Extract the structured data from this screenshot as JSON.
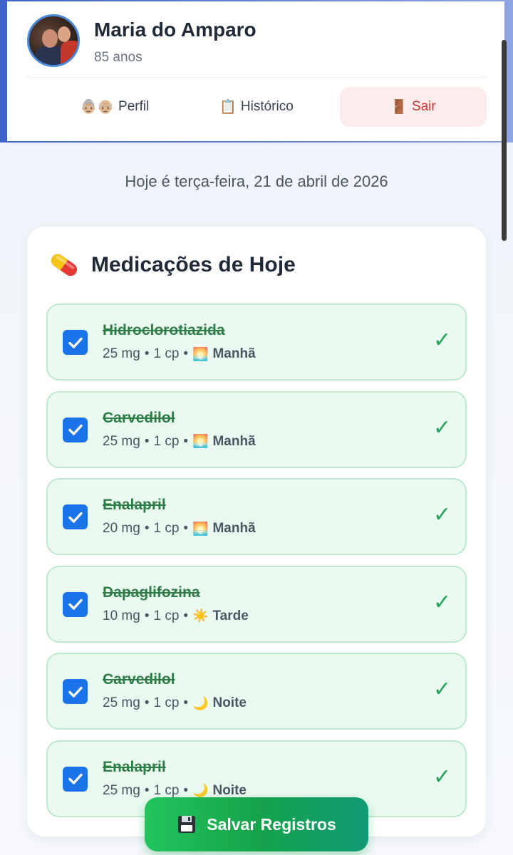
{
  "header": {
    "user_name": "Maria do Amparo",
    "user_age": "85 anos",
    "nav": {
      "profile": {
        "icon": "👵🏼👴🏼",
        "label": "Perfil"
      },
      "history": {
        "icon": "📋",
        "label": "Histórico"
      },
      "logout": {
        "icon": "🚪",
        "label": "Sair"
      }
    }
  },
  "date_text": "Hoje é terça-feira, 21 de abril de 2026",
  "medications_card": {
    "title": "Medicações de Hoje",
    "items": [
      {
        "name": "Hidroclorotiazida",
        "dose": "25 mg",
        "qty": "1 cp",
        "period_icon": "🌅",
        "period": "Manhã",
        "taken": true
      },
      {
        "name": "Carvedilol",
        "dose": "25 mg",
        "qty": "1 cp",
        "period_icon": "🌅",
        "period": "Manhã",
        "taken": true
      },
      {
        "name": "Enalapril",
        "dose": "20 mg",
        "qty": "1 cp",
        "period_icon": "🌅",
        "period": "Manhã",
        "taken": true
      },
      {
        "name": "Dapaglifozina",
        "dose": "10 mg",
        "qty": "1 cp",
        "period_icon": "☀️",
        "period": "Tarde",
        "taken": true
      },
      {
        "name": "Carvedilol",
        "dose": "25 mg",
        "qty": "1 cp",
        "period_icon": "🌙",
        "period": "Noite",
        "taken": true
      },
      {
        "name": "Enalapril",
        "dose": "25 mg",
        "qty": "1 cp",
        "period_icon": "🌙",
        "period": "Noite",
        "taken": true
      }
    ],
    "separator": "•",
    "done_mark": "✓"
  },
  "save_button": {
    "label": "Salvar Registros"
  },
  "colors": {
    "accent_blue": "#1a73e8",
    "done_green": "#22a35a",
    "logout_red": "#d0332f"
  }
}
